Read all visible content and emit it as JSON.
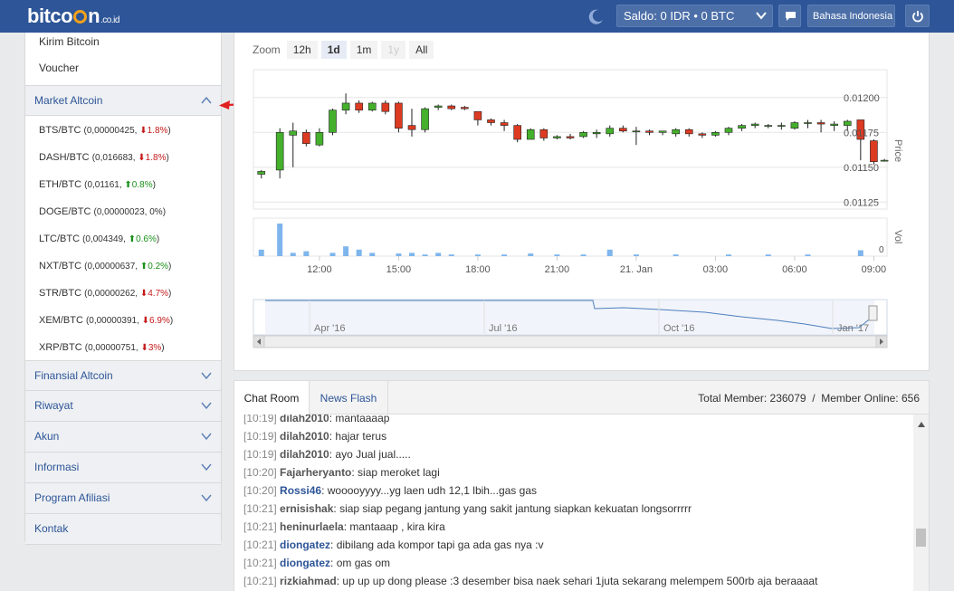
{
  "header": {
    "logo_text": "bitco",
    "logo_text_end": "n",
    "logo_suffix": ".co.id",
    "saldo_label": "Saldo: ",
    "saldo_value": "0 IDR • 0 BTC",
    "language": "Bahasa Indonesia",
    "colors": {
      "bar": "#2d5597",
      "logo_coin": "#f4a11a"
    }
  },
  "sidebar": {
    "top_items": [
      {
        "label": "Kirim Bitcoin"
      },
      {
        "label": "Voucher"
      }
    ],
    "market_section": "Market Altcoin",
    "altcoins": [
      {
        "pair": "BTS/BTC",
        "price": "0,00000425",
        "change": "1.8%",
        "dir": "down"
      },
      {
        "pair": "DASH/BTC",
        "price": "0,016683",
        "change": "1.8%",
        "dir": "down"
      },
      {
        "pair": "ETH/BTC",
        "price": "0,01161",
        "change": "0.8%",
        "dir": "up"
      },
      {
        "pair": "DOGE/BTC",
        "price": "0,00000023",
        "change": "0%",
        "dir": "flat"
      },
      {
        "pair": "LTC/BTC",
        "price": "0,004349",
        "change": "0.6%",
        "dir": "up"
      },
      {
        "pair": "NXT/BTC",
        "price": "0,00000637",
        "change": "0.2%",
        "dir": "up"
      },
      {
        "pair": "STR/BTC",
        "price": "0,00000262",
        "change": "4.7%",
        "dir": "down"
      },
      {
        "pair": "XEM/BTC",
        "price": "0,00000391",
        "change": "6.9%",
        "dir": "down"
      },
      {
        "pair": "XRP/BTC",
        "price": "0,00000751",
        "change": "3%",
        "dir": "down"
      }
    ],
    "sections": [
      {
        "label": "Financial Altcoin",
        "label_exact": "Finansial Altcoin"
      },
      {
        "label": "Riwayat"
      },
      {
        "label": "Akun"
      },
      {
        "label": "Informasi"
      },
      {
        "label": "Program Afiliasi"
      },
      {
        "label": "Kontak"
      }
    ]
  },
  "chart": {
    "zoom_label": "Zoom",
    "zoom_buttons": [
      "12h",
      "1d",
      "1m",
      "1y",
      "All"
    ],
    "zoom_active": "1d",
    "zoom_disabled": "1y",
    "price_axis_label": "Price",
    "volume_axis_label": "Vol",
    "price_ticks": [
      "0.01200",
      "0.01175",
      "0.01150",
      "0.01125"
    ],
    "volume_ticks": [
      "0"
    ],
    "time_ticks": [
      "12:00",
      "15:00",
      "18:00",
      "21:00",
      "21. Jan",
      "03:00",
      "06:00",
      "09:00"
    ],
    "navigator_ticks": [
      "Apr '16",
      "Jul '16",
      "Oct '16",
      "Jan '17"
    ],
    "colors": {
      "up": "#44b02c",
      "down": "#dd3a22",
      "volume": "#7eb5ec",
      "navigator": "#4d7fbd"
    }
  },
  "chat": {
    "tabs": [
      "Chat Room",
      "News Flash"
    ],
    "total_member": "Total Member: 236079",
    "separator": "/",
    "member_online": "Member Online: 656",
    "lines": [
      {
        "time": "[10:19]",
        "nick": "dilah2010",
        "msg": ": mantaaaap",
        "blue": false
      },
      {
        "time": "[10:19]",
        "nick": "dilah2010",
        "msg": ": hajar terus",
        "blue": false
      },
      {
        "time": "[10:19]",
        "nick": "dilah2010",
        "msg": ": ayo Jual jual.....",
        "blue": false
      },
      {
        "time": "[10:20]",
        "nick": "Fajarheryanto",
        "msg": ": siap meroket lagi",
        "blue": false
      },
      {
        "time": "[10:20]",
        "nick": "Rossi46",
        "msg": ": wooooyyyy...yg laen udh 12,1 lbih...gas gas",
        "blue": true
      },
      {
        "time": "[10:21]",
        "nick": "ernisishak",
        "msg": ": siap siap pegang jantung yang sakit jantung siapkan kekuatan longsorrrrr",
        "blue": false
      },
      {
        "time": "[10:21]",
        "nick": "heninurlaela",
        "msg": ": mantaaap , kira kira",
        "blue": false
      },
      {
        "time": "[10:21]",
        "nick": "diongatez",
        "msg": ": dibilang ada kompor tapi ga ada gas nya :v",
        "blue": true
      },
      {
        "time": "[10:21]",
        "nick": "diongatez",
        "msg": ": om gas om",
        "blue": true
      },
      {
        "time": "[10:21]",
        "nick": "rizkiahmad",
        "msg": ": up up up dong please :3 desember bisa naek sehari 1juta sekarang melempem 500rb aja beraaaat",
        "blue": false
      }
    ]
  },
  "chart_data": {
    "type": "candlestick",
    "title": "",
    "ylabel": "Price",
    "ylim": [
      0.0112,
      0.0122
    ],
    "x_ticks": [
      "12:00",
      "15:00",
      "18:00",
      "21:00",
      "21. Jan",
      "03:00",
      "06:00",
      "09:00"
    ],
    "x_range_hours": [
      9.5,
      33.5
    ],
    "candles": [
      {
        "t": 9.8,
        "o": 0.01145,
        "h": 0.01148,
        "l": 0.01142,
        "c": 0.01147
      },
      {
        "t": 10.5,
        "o": 0.01148,
        "h": 0.01178,
        "l": 0.01142,
        "c": 0.01175
      },
      {
        "t": 11.0,
        "o": 0.01173,
        "h": 0.01182,
        "l": 0.0115,
        "c": 0.01176
      },
      {
        "t": 11.5,
        "o": 0.01175,
        "h": 0.01177,
        "l": 0.01165,
        "c": 0.01167
      },
      {
        "t": 12.0,
        "o": 0.01166,
        "h": 0.01178,
        "l": 0.01165,
        "c": 0.01175
      },
      {
        "t": 12.5,
        "o": 0.01175,
        "h": 0.01192,
        "l": 0.01173,
        "c": 0.01191
      },
      {
        "t": 13.0,
        "o": 0.01191,
        "h": 0.01203,
        "l": 0.01188,
        "c": 0.01196
      },
      {
        "t": 13.5,
        "o": 0.01196,
        "h": 0.01198,
        "l": 0.01189,
        "c": 0.01191
      },
      {
        "t": 14.0,
        "o": 0.01191,
        "h": 0.01197,
        "l": 0.0119,
        "c": 0.01196
      },
      {
        "t": 14.5,
        "o": 0.01196,
        "h": 0.01198,
        "l": 0.01188,
        "c": 0.0119
      },
      {
        "t": 15.0,
        "o": 0.01196,
        "h": 0.01197,
        "l": 0.01175,
        "c": 0.01178
      },
      {
        "t": 15.5,
        "o": 0.0118,
        "h": 0.01192,
        "l": 0.01172,
        "c": 0.01177
      },
      {
        "t": 16.0,
        "o": 0.01177,
        "h": 0.01193,
        "l": 0.01175,
        "c": 0.01192
      },
      {
        "t": 16.5,
        "o": 0.01193,
        "h": 0.01195,
        "l": 0.01191,
        "c": 0.01194
      },
      {
        "t": 17.0,
        "o": 0.01194,
        "h": 0.01195,
        "l": 0.01191,
        "c": 0.01192
      },
      {
        "t": 17.5,
        "o": 0.01193,
        "h": 0.01194,
        "l": 0.01191,
        "c": 0.01192
      },
      {
        "t": 18.0,
        "o": 0.0119,
        "h": 0.0119,
        "l": 0.0118,
        "c": 0.01184
      },
      {
        "t": 18.5,
        "o": 0.01184,
        "h": 0.01185,
        "l": 0.0118,
        "c": 0.01182
      },
      {
        "t": 19.0,
        "o": 0.01182,
        "h": 0.01184,
        "l": 0.01176,
        "c": 0.0118
      },
      {
        "t": 19.5,
        "o": 0.0118,
        "h": 0.01181,
        "l": 0.01168,
        "c": 0.0117
      },
      {
        "t": 20.0,
        "o": 0.0117,
        "h": 0.01178,
        "l": 0.0117,
        "c": 0.01177
      },
      {
        "t": 20.5,
        "o": 0.01177,
        "h": 0.01178,
        "l": 0.01169,
        "c": 0.01171
      },
      {
        "t": 21.0,
        "o": 0.01171,
        "h": 0.01173,
        "l": 0.0117,
        "c": 0.01172
      },
      {
        "t": 21.5,
        "o": 0.01172,
        "h": 0.01174,
        "l": 0.0117,
        "c": 0.01171
      },
      {
        "t": 22.0,
        "o": 0.01172,
        "h": 0.01176,
        "l": 0.01171,
        "c": 0.01175
      },
      {
        "t": 22.5,
        "o": 0.01174,
        "h": 0.01177,
        "l": 0.01171,
        "c": 0.01175
      },
      {
        "t": 23.0,
        "o": 0.01174,
        "h": 0.0118,
        "l": 0.01172,
        "c": 0.01178
      },
      {
        "t": 23.5,
        "o": 0.01178,
        "h": 0.0118,
        "l": 0.01175,
        "c": 0.01176
      },
      {
        "t": 24.0,
        "o": 0.01176,
        "h": 0.01179,
        "l": 0.01166,
        "c": 0.01176
      },
      {
        "t": 24.5,
        "o": 0.01176,
        "h": 0.01177,
        "l": 0.01173,
        "c": 0.01175
      },
      {
        "t": 25.0,
        "o": 0.01175,
        "h": 0.01176,
        "l": 0.01173,
        "c": 0.01176
      },
      {
        "t": 25.5,
        "o": 0.01174,
        "h": 0.01178,
        "l": 0.01172,
        "c": 0.01177
      },
      {
        "t": 26.0,
        "o": 0.01177,
        "h": 0.01178,
        "l": 0.01172,
        "c": 0.01174
      },
      {
        "t": 26.5,
        "o": 0.01174,
        "h": 0.01175,
        "l": 0.01171,
        "c": 0.01173
      },
      {
        "t": 27.0,
        "o": 0.01173,
        "h": 0.01176,
        "l": 0.01172,
        "c": 0.01175
      },
      {
        "t": 27.5,
        "o": 0.01175,
        "h": 0.01179,
        "l": 0.01173,
        "c": 0.01178
      },
      {
        "t": 28.0,
        "o": 0.01178,
        "h": 0.01181,
        "l": 0.01176,
        "c": 0.0118
      },
      {
        "t": 28.5,
        "o": 0.0118,
        "h": 0.01182,
        "l": 0.01178,
        "c": 0.01181
      },
      {
        "t": 29.0,
        "o": 0.0118,
        "h": 0.01181,
        "l": 0.01178,
        "c": 0.0118
      },
      {
        "t": 29.5,
        "o": 0.0118,
        "h": 0.01182,
        "l": 0.01177,
        "c": 0.0118
      },
      {
        "t": 30.0,
        "o": 0.01178,
        "h": 0.01183,
        "l": 0.01177,
        "c": 0.01182
      },
      {
        "t": 30.5,
        "o": 0.01182,
        "h": 0.01184,
        "l": 0.01178,
        "c": 0.01182
      },
      {
        "t": 31.0,
        "o": 0.01182,
        "h": 0.01184,
        "l": 0.01175,
        "c": 0.01181
      },
      {
        "t": 31.5,
        "o": 0.0118,
        "h": 0.01183,
        "l": 0.01176,
        "c": 0.01181
      },
      {
        "t": 32.0,
        "o": 0.0118,
        "h": 0.01184,
        "l": 0.01176,
        "c": 0.01183
      },
      {
        "t": 32.5,
        "o": 0.01184,
        "h": 0.01184,
        "l": 0.01155,
        "c": 0.0117
      },
      {
        "t": 33.0,
        "o": 0.01169,
        "h": 0.0117,
        "l": 0.01152,
        "c": 0.01154
      },
      {
        "t": 33.4,
        "o": 0.01155,
        "h": 0.01156,
        "l": 0.01154,
        "c": 0.01155
      }
    ],
    "volume": [
      {
        "t": 9.8,
        "v": 0.2
      },
      {
        "t": 10.5,
        "v": 1.0
      },
      {
        "t": 11.0,
        "v": 0.1
      },
      {
        "t": 11.5,
        "v": 0.15
      },
      {
        "t": 12.5,
        "v": 0.1
      },
      {
        "t": 13.0,
        "v": 0.3
      },
      {
        "t": 13.5,
        "v": 0.2
      },
      {
        "t": 14.0,
        "v": 0.1
      },
      {
        "t": 15.0,
        "v": 0.08
      },
      {
        "t": 15.5,
        "v": 0.1
      },
      {
        "t": 16.0,
        "v": 0.05
      },
      {
        "t": 16.5,
        "v": 0.1
      },
      {
        "t": 17.0,
        "v": 0.05
      },
      {
        "t": 18.0,
        "v": 0.05
      },
      {
        "t": 19.0,
        "v": 0.05
      },
      {
        "t": 20.0,
        "v": 0.08
      },
      {
        "t": 21.0,
        "v": 0.05
      },
      {
        "t": 22.0,
        "v": 0.05
      },
      {
        "t": 23.0,
        "v": 0.2
      },
      {
        "t": 24.0,
        "v": 0.05
      },
      {
        "t": 25.5,
        "v": 0.05
      },
      {
        "t": 27.5,
        "v": 0.05
      },
      {
        "t": 29.0,
        "v": 0.05
      },
      {
        "t": 30.5,
        "v": 0.05
      },
      {
        "t": 32.5,
        "v": 0.18
      }
    ]
  }
}
